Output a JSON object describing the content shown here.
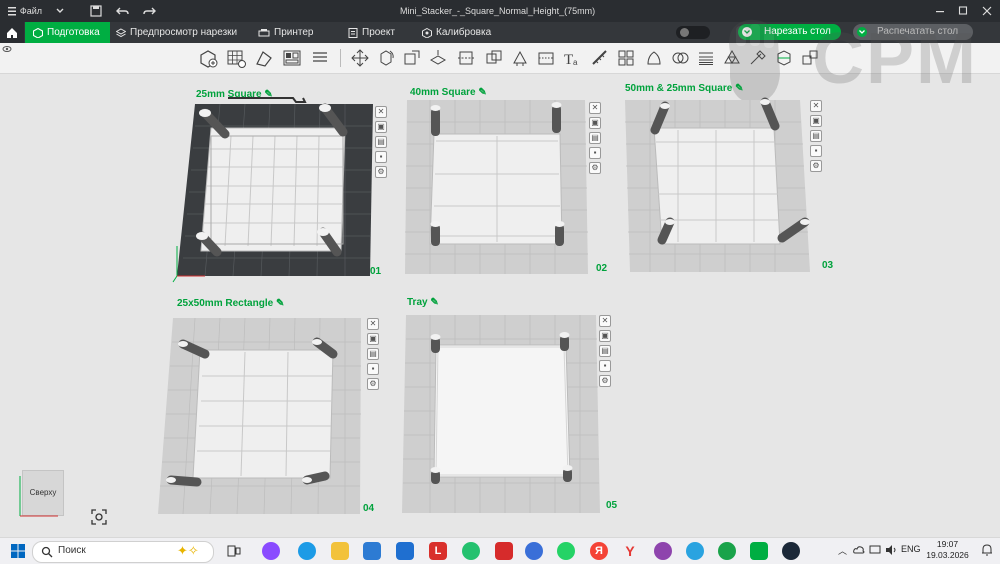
{
  "titlebar": {
    "menu_label": "Файл",
    "document_title": "Mini_Stacker_-_Square_Normal_Height_(75mm)"
  },
  "tabs": {
    "prepare": "Подготовка",
    "preview": "Предпросмотр нарезки",
    "printer": "Принтер",
    "project": "Проект",
    "calibration": "Калибровка"
  },
  "actions": {
    "slice": "Нарезать стол",
    "print": "Распечатать стол"
  },
  "watermark": "CPM",
  "plates": [
    {
      "title": "25mm Square",
      "number": "01"
    },
    {
      "title": "40mm Square",
      "number": "02"
    },
    {
      "title": "50mm & 25mm Square",
      "number": "03"
    },
    {
      "title": "25x50mm Rectangle",
      "number": "04"
    },
    {
      "title": "Tray",
      "number": "05"
    }
  ],
  "view_cube": {
    "label": "Сверху"
  },
  "taskbar": {
    "search_placeholder": "Поиск",
    "language": "ENG",
    "time": "19:07",
    "date": "19.03.2026"
  },
  "colors": {
    "accent": "#00ae42",
    "titlebar": "#2a2d31",
    "tabbar": "#34373b",
    "plate_active": "#3a3d40",
    "plate_inactive": "#cfcfcf"
  }
}
